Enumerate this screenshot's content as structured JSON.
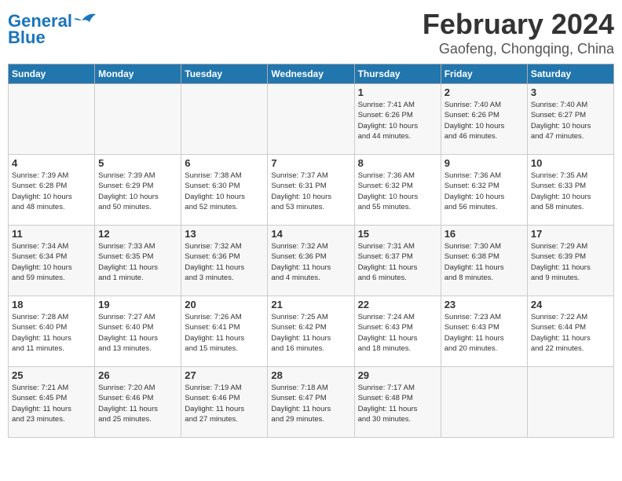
{
  "header": {
    "logo_line1": "General",
    "logo_line2": "Blue",
    "main_title": "February 2024",
    "sub_title": "Gaofeng, Chongqing, China"
  },
  "weekdays": [
    "Sunday",
    "Monday",
    "Tuesday",
    "Wednesday",
    "Thursday",
    "Friday",
    "Saturday"
  ],
  "weeks": [
    [
      {
        "day": "",
        "info": ""
      },
      {
        "day": "",
        "info": ""
      },
      {
        "day": "",
        "info": ""
      },
      {
        "day": "",
        "info": ""
      },
      {
        "day": "1",
        "info": "Sunrise: 7:41 AM\nSunset: 6:26 PM\nDaylight: 10 hours\nand 44 minutes."
      },
      {
        "day": "2",
        "info": "Sunrise: 7:40 AM\nSunset: 6:26 PM\nDaylight: 10 hours\nand 46 minutes."
      },
      {
        "day": "3",
        "info": "Sunrise: 7:40 AM\nSunset: 6:27 PM\nDaylight: 10 hours\nand 47 minutes."
      }
    ],
    [
      {
        "day": "4",
        "info": "Sunrise: 7:39 AM\nSunset: 6:28 PM\nDaylight: 10 hours\nand 48 minutes."
      },
      {
        "day": "5",
        "info": "Sunrise: 7:39 AM\nSunset: 6:29 PM\nDaylight: 10 hours\nand 50 minutes."
      },
      {
        "day": "6",
        "info": "Sunrise: 7:38 AM\nSunset: 6:30 PM\nDaylight: 10 hours\nand 52 minutes."
      },
      {
        "day": "7",
        "info": "Sunrise: 7:37 AM\nSunset: 6:31 PM\nDaylight: 10 hours\nand 53 minutes."
      },
      {
        "day": "8",
        "info": "Sunrise: 7:36 AM\nSunset: 6:32 PM\nDaylight: 10 hours\nand 55 minutes."
      },
      {
        "day": "9",
        "info": "Sunrise: 7:36 AM\nSunset: 6:32 PM\nDaylight: 10 hours\nand 56 minutes."
      },
      {
        "day": "10",
        "info": "Sunrise: 7:35 AM\nSunset: 6:33 PM\nDaylight: 10 hours\nand 58 minutes."
      }
    ],
    [
      {
        "day": "11",
        "info": "Sunrise: 7:34 AM\nSunset: 6:34 PM\nDaylight: 10 hours\nand 59 minutes."
      },
      {
        "day": "12",
        "info": "Sunrise: 7:33 AM\nSunset: 6:35 PM\nDaylight: 11 hours\nand 1 minute."
      },
      {
        "day": "13",
        "info": "Sunrise: 7:32 AM\nSunset: 6:36 PM\nDaylight: 11 hours\nand 3 minutes."
      },
      {
        "day": "14",
        "info": "Sunrise: 7:32 AM\nSunset: 6:36 PM\nDaylight: 11 hours\nand 4 minutes."
      },
      {
        "day": "15",
        "info": "Sunrise: 7:31 AM\nSunset: 6:37 PM\nDaylight: 11 hours\nand 6 minutes."
      },
      {
        "day": "16",
        "info": "Sunrise: 7:30 AM\nSunset: 6:38 PM\nDaylight: 11 hours\nand 8 minutes."
      },
      {
        "day": "17",
        "info": "Sunrise: 7:29 AM\nSunset: 6:39 PM\nDaylight: 11 hours\nand 9 minutes."
      }
    ],
    [
      {
        "day": "18",
        "info": "Sunrise: 7:28 AM\nSunset: 6:40 PM\nDaylight: 11 hours\nand 11 minutes."
      },
      {
        "day": "19",
        "info": "Sunrise: 7:27 AM\nSunset: 6:40 PM\nDaylight: 11 hours\nand 13 minutes."
      },
      {
        "day": "20",
        "info": "Sunrise: 7:26 AM\nSunset: 6:41 PM\nDaylight: 11 hours\nand 15 minutes."
      },
      {
        "day": "21",
        "info": "Sunrise: 7:25 AM\nSunset: 6:42 PM\nDaylight: 11 hours\nand 16 minutes."
      },
      {
        "day": "22",
        "info": "Sunrise: 7:24 AM\nSunset: 6:43 PM\nDaylight: 11 hours\nand 18 minutes."
      },
      {
        "day": "23",
        "info": "Sunrise: 7:23 AM\nSunset: 6:43 PM\nDaylight: 11 hours\nand 20 minutes."
      },
      {
        "day": "24",
        "info": "Sunrise: 7:22 AM\nSunset: 6:44 PM\nDaylight: 11 hours\nand 22 minutes."
      }
    ],
    [
      {
        "day": "25",
        "info": "Sunrise: 7:21 AM\nSunset: 6:45 PM\nDaylight: 11 hours\nand 23 minutes."
      },
      {
        "day": "26",
        "info": "Sunrise: 7:20 AM\nSunset: 6:46 PM\nDaylight: 11 hours\nand 25 minutes."
      },
      {
        "day": "27",
        "info": "Sunrise: 7:19 AM\nSunset: 6:46 PM\nDaylight: 11 hours\nand 27 minutes."
      },
      {
        "day": "28",
        "info": "Sunrise: 7:18 AM\nSunset: 6:47 PM\nDaylight: 11 hours\nand 29 minutes."
      },
      {
        "day": "29",
        "info": "Sunrise: 7:17 AM\nSunset: 6:48 PM\nDaylight: 11 hours\nand 30 minutes."
      },
      {
        "day": "",
        "info": ""
      },
      {
        "day": "",
        "info": ""
      }
    ]
  ]
}
